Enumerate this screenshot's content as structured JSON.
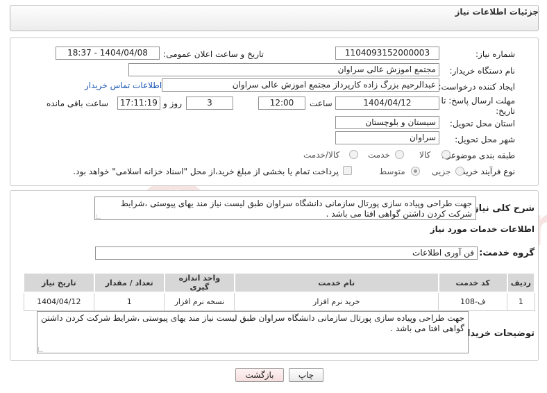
{
  "header": {
    "title": "جزئیات اطلاعات نیاز"
  },
  "fields": {
    "need_number_label": "شماره نیاز:",
    "need_number": "1104093152000003",
    "announce_label": "تاریخ و ساعت اعلان عمومی:",
    "announce_value": "1404/04/08 - 18:37",
    "buyer_org_label": "نام دستگاه خریدار:",
    "buyer_org": "مجتمع اموزش عالی سراوان",
    "creator_label": "ایجاد کننده درخواست:",
    "creator": "عبدالرحیم بزرگ زاده کارپرداز مجتمع اموزش عالی سراوان",
    "contact_link": "اطلاعات تماس خریدار",
    "deadline_label_1": "مهلت ارسال پاسخ: تا",
    "deadline_label_2": "تاریخ:",
    "deadline_date": "1404/04/12",
    "time_label": "ساعت",
    "deadline_time": "12:00",
    "days_value": "3",
    "days_label": "روز و",
    "remaining_time": "17:11:19",
    "remaining_label": "ساعت باقی مانده",
    "province_label": "استان محل تحویل:",
    "province": "سیستان و بلوچستان",
    "city_label": "شهر محل تحویل:",
    "city": "سراوان",
    "category_label": "طبقه بندی موضوعی:",
    "category_options": [
      {
        "label": "کالا",
        "checked": false
      },
      {
        "label": "خدمت",
        "checked": false
      },
      {
        "label": "کالا/خدمت",
        "checked": false
      }
    ],
    "process_label": "نوع فرآیند خرید :",
    "process_options": [
      {
        "label": "جزیی",
        "checked": false
      },
      {
        "label": "متوسط",
        "checked": true
      }
    ],
    "payment_note": "پرداخت تمام یا بخشی از مبلغ خرید،از محل \"اسناد خزانه اسلامی\" خواهد بود."
  },
  "summary": {
    "label": "شرح کلی نیاز:",
    "text": "جهت طراحی  وپیاده سازی  پورتال  سازمانی دانشگاه سراوان طبق لیست نیاز مند یهای  پیوستی  ،شرایط شرکت کردن داشتن  گواهی افتا  می باشد ."
  },
  "services": {
    "section_title": "اطلاعات خدمات مورد نیاز",
    "group_label": "گروه خدمت:",
    "group_value": "فن آوری اطلاعات",
    "columns": [
      "ردیف",
      "کد خدمت",
      "نام خدمت",
      "واحد اندازه گیری",
      "تعداد / مقدار",
      "تاریخ نیاز"
    ],
    "rows": [
      [
        "1",
        "ف-108",
        "خرید نرم افزار",
        "نسخه نرم افزار",
        "1",
        "1404/04/12"
      ]
    ]
  },
  "buyer_notes": {
    "label": "توضیحات خریدار:",
    "text": "جهت طراحی  وپیاده سازی  پورتال  سازمانی دانشگاه سراوان طبق لیست نیاز مند یهای  پیوستی  ،شرایط شرکت کردن داشتن  گواهی افتا  می باشد ."
  },
  "buttons": {
    "print": "چاپ",
    "back": "بازگشت"
  },
  "watermark_text": "AriaTender.neT",
  "colors": {
    "link": "#1a55b4",
    "accent_red": "#c0392b"
  }
}
